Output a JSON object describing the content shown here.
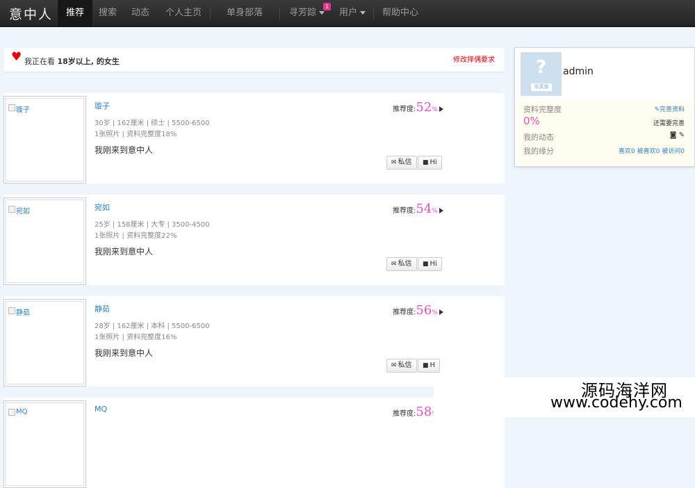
{
  "brand": "意中人",
  "nav": [
    {
      "label": "推荐",
      "active": true
    },
    {
      "label": "搜索"
    },
    {
      "label": "动态"
    },
    {
      "label": "个人主页"
    },
    {
      "label": "单身部落"
    },
    {
      "label": "寻芳踪",
      "badge": "1"
    },
    {
      "label": "用户"
    },
    {
      "label": "帮助中心"
    }
  ],
  "filter": {
    "prefix": "我正在看 ",
    "criteria": "18岁以上, 的女生",
    "link": "修改择偶要求"
  },
  "cards": [
    {
      "name": "璇子",
      "info": "30岁 | 162厘米 | 硕士 | 5500-6500",
      "photos": "1张照片 | 资料完整度18%",
      "intro": "我刚来到意中人",
      "score_label": "推荐度:",
      "score": "52",
      "pct": "%",
      "msg": "私信",
      "hi": "Hi"
    },
    {
      "name": "宛如",
      "info": "25岁 | 158厘米 | 大专 | 3500-4500",
      "photos": "1张照片 | 资料完整度22%",
      "intro": "我刚来到意中人",
      "score_label": "推荐度:",
      "score": "54",
      "pct": "%",
      "msg": "私信",
      "hi": "Hi"
    },
    {
      "name": "静茹",
      "info": "28岁 | 162厘米 | 本科 | 5500-6500",
      "photos": "1张照片 | 资料完整度16%",
      "intro": "我刚来到意中人",
      "score_label": "推荐度:",
      "score": "56",
      "pct": "%",
      "msg": "私信",
      "hi": "H"
    },
    {
      "name": "MQ",
      "info": "",
      "photos": "",
      "intro": "",
      "score_label": "推荐度:",
      "score": "58",
      "pct": "%",
      "msg": "",
      "hi": ""
    }
  ],
  "profile": {
    "username": "admin",
    "avatar_q": "?",
    "avatar_tag": "非真像",
    "completeness_label": "资料完整度",
    "complete_link": "完善资料",
    "percent": "0%",
    "need_more": "还需要完善",
    "dynamics_label": "我的动态",
    "fate_label": "我的缘分",
    "likes": "喜欢0",
    "liked": "被喜欢0",
    "visited": "被访问0"
  },
  "watermark": {
    "cn": "源码海洋网",
    "url": "www.codehy.com"
  }
}
